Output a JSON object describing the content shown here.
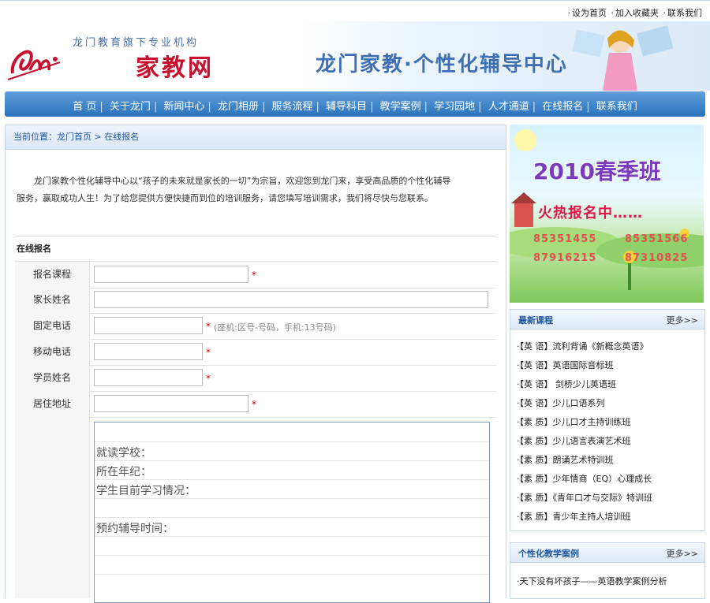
{
  "toplinks": [
    "设为首页",
    "加入收藏夹",
    "联系我们"
  ],
  "header": {
    "logo_sub": "龙门教育旗下专业机构",
    "logo_main": "家教网",
    "banner_text": "龙门家教·个性化辅导中心"
  },
  "nav": [
    "首 页",
    "关于龙门",
    "新闻中心",
    "龙门相册",
    "服务流程",
    "辅导科目",
    "教学案例",
    "学习园地",
    "人才通道",
    "在线报名",
    "联系我们"
  ],
  "breadcrumb": {
    "label": "当前位置：",
    "home": "龙门首页",
    "sep": ">",
    "current": "在线报名"
  },
  "intro": {
    "line1": "龙门家教个性化辅导中心以“孩子的未来就是家长的一切”为宗旨，欢迎您到龙门来，享受高品质的个性化辅导",
    "line2": "服务，赢取成功人生！为了给您提供方便快捷而到位的培训服务，请您填写培训需求，我们将尽快与您联系。"
  },
  "form": {
    "title": "在线报名",
    "fields": [
      {
        "label": "报名课程",
        "required": "*",
        "hint": ""
      },
      {
        "label": "家长姓名",
        "required": "",
        "hint": ""
      },
      {
        "label": "固定电话",
        "required": "*",
        "hint": "(座机:区号-号码，手机:13号码)"
      },
      {
        "label": "移动电话",
        "required": "*",
        "hint": ""
      },
      {
        "label": "学员姓名",
        "required": "*",
        "hint": ""
      },
      {
        "label": "居住地址",
        "required": "*",
        "hint": ""
      }
    ],
    "textarea_lines": [
      "就读学校：",
      "所在年纪：",
      "学生目前学习情况：",
      "",
      "预约辅导时间："
    ]
  },
  "promo": {
    "title": "2010春季班",
    "subtitle": "火热报名中……",
    "phones": [
      "85351455",
      "85351566",
      "87916215",
      "87310825"
    ]
  },
  "latest_courses": {
    "title": "最新课程",
    "more": "更多>>",
    "items": [
      "·【英 语】流利背诵《新概念英语》",
      "·【英 语】英语国际音标班",
      "·【英 语】 剑桥少儿英语班",
      "·【英 语】少儿口语系列",
      "·【素 质】少儿口才主持训练班",
      "·【素 质】少儿语言表演艺术班",
      "·【素 质】朗诵艺术特训班",
      "·【素 质】少年情商（EQ）心理成长",
      "·【素 质】《青年口才与交际》特训班",
      "·【素 质】青少年主持人培训班"
    ]
  },
  "cases": {
    "title": "个性化教学案例",
    "more": "更多>>",
    "items": [
      "·天下没有坏孩子——英语教学案例分析"
    ]
  },
  "colors": {
    "nav": "#2a72bd",
    "accent": "#1e56a0",
    "required": "#cc0000",
    "logo": "#c8102e"
  }
}
